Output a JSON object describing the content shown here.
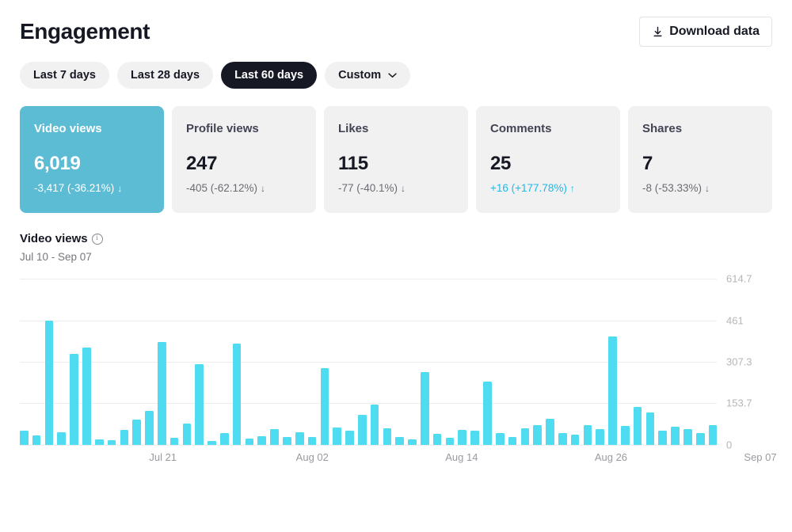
{
  "header": {
    "title": "Engagement",
    "download_label": "Download data",
    "download_icon": "download-arrow-icon"
  },
  "ranges": [
    {
      "label": "Last 7 days",
      "active": false,
      "chevron": false
    },
    {
      "label": "Last 28 days",
      "active": false,
      "chevron": false
    },
    {
      "label": "Last 60 days",
      "active": true,
      "chevron": false
    },
    {
      "label": "Custom",
      "active": false,
      "chevron": true,
      "chevron_icon": "chevron-down-icon"
    }
  ],
  "cards": [
    {
      "name": "video-views",
      "label": "Video views",
      "value": "6,019",
      "delta": "-3,417 (-36.21%)",
      "direction": "down",
      "arrow": "↓",
      "selected": true
    },
    {
      "name": "profile-views",
      "label": "Profile views",
      "value": "247",
      "delta": "-405 (-62.12%)",
      "direction": "down",
      "arrow": "↓",
      "selected": false
    },
    {
      "name": "likes",
      "label": "Likes",
      "value": "115",
      "delta": "-77 (-40.1%)",
      "direction": "down",
      "arrow": "↓",
      "selected": false
    },
    {
      "name": "comments",
      "label": "Comments",
      "value": "25",
      "delta": "+16 (+177.78%)",
      "direction": "up",
      "arrow": "↑",
      "selected": false
    },
    {
      "name": "shares",
      "label": "Shares",
      "value": "7",
      "delta": "-8 (-53.33%)",
      "direction": "down",
      "arrow": "↑",
      "selected": false
    }
  ],
  "chart_header": {
    "title": "Video views",
    "info_icon": "info-icon",
    "date_range": "Jul 10 - Sep 07"
  },
  "colors": {
    "bar": "#4fdcf0",
    "selected_card": "#5cbcd4",
    "accent_up": "#20b8e5",
    "text_primary": "#161823",
    "grid": "#ededee"
  },
  "chart_data": {
    "type": "bar",
    "title": "Video views",
    "subtitle": "Jul 10 - Sep 07",
    "xlabel": "",
    "ylabel": "",
    "ylim": [
      0,
      614.7
    ],
    "grid": true,
    "legend": false,
    "ytick_labels": [
      "614.7",
      "461",
      "307.3",
      "153.7",
      "0"
    ],
    "ytick_values": [
      614.7,
      461,
      307.3,
      153.7,
      0
    ],
    "xtick_labels": [
      "Jul 21",
      "Aug 02",
      "Aug 14",
      "Aug 26",
      "Sep 07"
    ],
    "xtick_indices": [
      11,
      23,
      35,
      47,
      59
    ],
    "categories": [
      "Jul 10",
      "Jul 11",
      "Jul 12",
      "Jul 13",
      "Jul 14",
      "Jul 15",
      "Jul 16",
      "Jul 17",
      "Jul 18",
      "Jul 19",
      "Jul 20",
      "Jul 21",
      "Jul 22",
      "Jul 23",
      "Jul 24",
      "Jul 25",
      "Jul 26",
      "Jul 27",
      "Jul 28",
      "Jul 29",
      "Jul 30",
      "Jul 31",
      "Aug 01",
      "Aug 02",
      "Aug 03",
      "Aug 04",
      "Aug 05",
      "Aug 06",
      "Aug 07",
      "Aug 08",
      "Aug 09",
      "Aug 10",
      "Aug 11",
      "Aug 12",
      "Aug 13",
      "Aug 14",
      "Aug 15",
      "Aug 16",
      "Aug 17",
      "Aug 18",
      "Aug 19",
      "Aug 20",
      "Aug 21",
      "Aug 22",
      "Aug 23",
      "Aug 24",
      "Aug 25",
      "Aug 26",
      "Aug 27",
      "Aug 28",
      "Aug 29",
      "Aug 30",
      "Aug 31",
      "Sep 01",
      "Sep 02",
      "Sep 03",
      "Sep 04",
      "Sep 05",
      "Sep 06",
      "Sep 07"
    ],
    "values": [
      52,
      35,
      461,
      48,
      338,
      360,
      20,
      18,
      55,
      95,
      125,
      380,
      25,
      80,
      300,
      15,
      45,
      375,
      22,
      32,
      60,
      28,
      48,
      30,
      283,
      65,
      52,
      110,
      150,
      62,
      30,
      20,
      270,
      40,
      25,
      55,
      52,
      235,
      45,
      28,
      62,
      72,
      98,
      45,
      38,
      72,
      58,
      400,
      70,
      140,
      120,
      52,
      68,
      58,
      45,
      72
    ],
    "values_note": "Bar heights read against gridlines at 0/153.7/307.3/461/614.7"
  }
}
